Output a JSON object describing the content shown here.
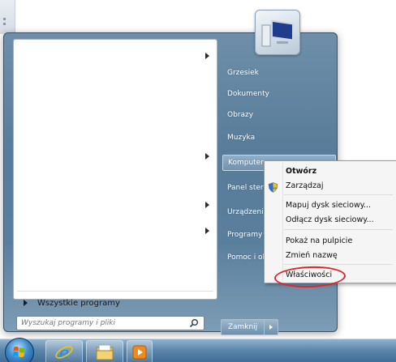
{
  "start_menu": {
    "left_pane": {
      "all_programs_label": "Wszystkie programy"
    },
    "search": {
      "placeholder": "Wyszukaj programy i pliki"
    },
    "right_items": [
      {
        "label": "Grzesiek"
      },
      {
        "label": "Dokumenty"
      },
      {
        "label": "Obrazy"
      },
      {
        "label": "Muzyka"
      },
      {
        "label": "Komputer"
      },
      {
        "label": "Panel sterow"
      },
      {
        "label": "Urządzenia i"
      },
      {
        "label": "Programy d"
      },
      {
        "label": "Pomoc i obs"
      }
    ],
    "shutdown_label": "Zamknij"
  },
  "context_menu": {
    "items": [
      {
        "label": "Otwórz"
      },
      {
        "label": "Zarządzaj"
      },
      {
        "label": "Mapuj dysk sieciowy..."
      },
      {
        "label": "Odłącz dysk sieciowy..."
      },
      {
        "label": "Pokaż na pulpicie"
      },
      {
        "label": "Zmień nazwę"
      },
      {
        "label": "Właściwości"
      }
    ]
  },
  "colors": {
    "highlight_circle": "#e2252a",
    "taskbar": "#4f7aa2"
  }
}
